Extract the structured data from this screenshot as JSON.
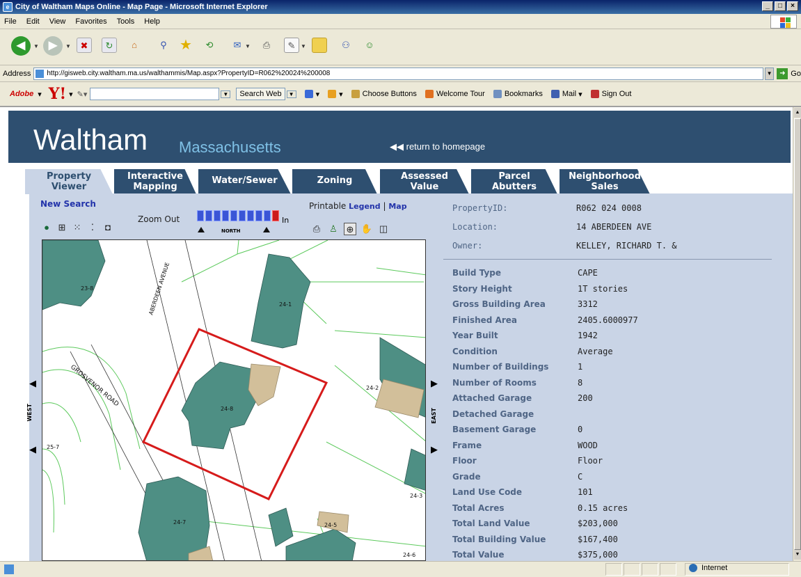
{
  "window": {
    "title": "City of Waltham Maps Online - Map Page - Microsoft Internet Explorer",
    "controls": [
      "_",
      "□",
      "×"
    ]
  },
  "menu": [
    "File",
    "Edit",
    "View",
    "Favorites",
    "Tools",
    "Help"
  ],
  "address": {
    "label": "Address",
    "url": "http://gisweb.city.waltham.ma.us/walthammis/Map.aspx?PropertyID=R062%20024%200008",
    "go": "Go"
  },
  "links": {
    "adobe": "Adobe",
    "yahoo": "Y!",
    "search_web": "Search Web",
    "choose_buttons": "Choose Buttons",
    "welcome_tour": "Welcome Tour",
    "bookmarks": "Bookmarks",
    "mail": "Mail",
    "sign_out": "Sign Out"
  },
  "header": {
    "city": "Waltham",
    "state": "Massachusetts",
    "home_link": "return to homepage"
  },
  "tabs": [
    {
      "label": "Property\nViewer",
      "active": true
    },
    {
      "label": "Interactive\nMapping",
      "active": false
    },
    {
      "label": "Water/Sewer",
      "active": false
    },
    {
      "label": "Zoning",
      "active": false
    },
    {
      "label": "Assessed\nValue",
      "active": false
    },
    {
      "label": "Parcel\nAbutters",
      "active": false
    },
    {
      "label": "Neighborhood\nSales",
      "active": false
    }
  ],
  "map_tools": {
    "new_search": "New Search",
    "printable": "Printable",
    "legend": "Legend",
    "separator": "|",
    "map": "Map",
    "zoom_out": "Zoom Out",
    "zoom_in": "In",
    "north": "NORTH",
    "zoom_level_selected": 9,
    "zoom_levels": 10
  },
  "map": {
    "west": "WEST",
    "east": "EAST",
    "street_labels": [
      "ABERDEEN AVENUE",
      "GROSVENOR ROAD"
    ],
    "parcel_labels": [
      "23-8",
      "24-1",
      "24-2",
      "24-8",
      "25-7",
      "24-3",
      "24-7",
      "24-6",
      "24-5"
    ]
  },
  "property_header": [
    {
      "label": "PropertyID:",
      "value": "R062 024 0008"
    },
    {
      "label": "Location:",
      "value": "14 ABERDEEN AVE"
    },
    {
      "label": "Owner:",
      "value": "KELLEY, RICHARD T. &"
    }
  ],
  "property_details": [
    {
      "label": "Build Type",
      "value": "CAPE"
    },
    {
      "label": "Story Height",
      "value": "1T stories"
    },
    {
      "label": "Gross Building Area",
      "value": "3312"
    },
    {
      "label": "Finished Area",
      "value": "2405.6000977"
    },
    {
      "label": "Year Built",
      "value": "1942"
    },
    {
      "label": "Condition",
      "value": "Average"
    },
    {
      "label": "Number of Buildings",
      "value": "1"
    },
    {
      "label": "Number of Rooms",
      "value": "8"
    },
    {
      "label": "Attached Garage",
      "value": "200"
    },
    {
      "label": "Detached Garage",
      "value": ""
    },
    {
      "label": "Basement Garage",
      "value": "0"
    },
    {
      "label": "Frame",
      "value": "WOOD"
    },
    {
      "label": "Floor",
      "value": "Floor"
    },
    {
      "label": "Grade",
      "value": "C"
    },
    {
      "label": "Land Use Code",
      "value": "101"
    },
    {
      "label": "Total Acres",
      "value": "0.15 acres"
    },
    {
      "label": "Total Land Value",
      "value": "$203,000"
    },
    {
      "label": "Total Building Value",
      "value": "$167,400"
    },
    {
      "label": "Total Value",
      "value": "$375,000"
    }
  ],
  "status": {
    "zone": "Internet"
  },
  "colors": {
    "header": "#2e4f70",
    "panel": "#c9d4e6",
    "parcel_outline": "#d61b1b",
    "building": "#4e8f84",
    "garage": "#d2bf9a",
    "lot_lines": "#5bc95b"
  }
}
